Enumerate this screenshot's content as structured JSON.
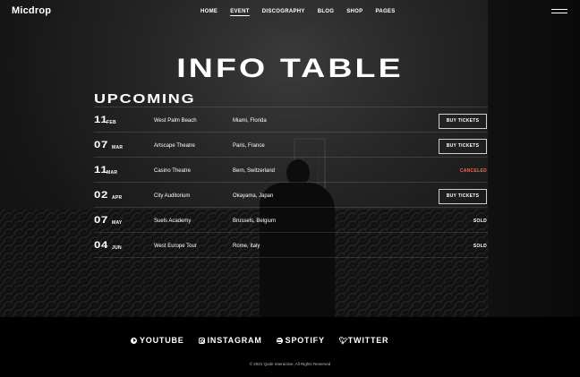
{
  "header": {
    "logo": "Micdrop",
    "nav": [
      "HOME",
      "EVENT",
      "DISCOGRAPHY",
      "BLOG",
      "SHOP",
      "PAGES"
    ],
    "active_nav": "EVENT"
  },
  "page_title": "INFO TABLE",
  "section_title": "UPCOMING",
  "events": [
    {
      "day": "11",
      "month": "FEB",
      "venue": "West Palm Beach",
      "location": "Miami, Florida",
      "action": "BUY TICKETS"
    },
    {
      "day": "07",
      "month": "MAR",
      "venue": "Artscape Theatre",
      "location": "Paris, France",
      "action": "BUY TICKETS"
    },
    {
      "day": "11",
      "month": "MAR",
      "venue": "Casino Theatre",
      "location": "Bern, Switzerland",
      "status": "CANCELED"
    },
    {
      "day": "02",
      "month": "APR",
      "venue": "City Auditorium",
      "location": "Okayama, Japan",
      "action": "BUY TICKETS"
    },
    {
      "day": "07",
      "month": "MAY",
      "venue": "Suels Academy",
      "location": "Brussels, Belgium",
      "status": "SOLD"
    },
    {
      "day": "04",
      "month": "JUN",
      "venue": "West Europe Tour",
      "location": "Rome, Italy",
      "status": "SOLD"
    }
  ],
  "footer": {
    "socials": [
      {
        "label": "YOUTUBE",
        "icon": "youtube-icon"
      },
      {
        "label": "INSTAGRAM",
        "icon": "instagram-icon"
      },
      {
        "label": "SPOTIFY",
        "icon": "spotify-icon"
      },
      {
        "label": "TWITTER",
        "icon": "twitter-icon"
      }
    ],
    "copyright": "© 2021 Qode Interactive, All Rights Reserved"
  },
  "colors": {
    "canceled": "#e06f5e",
    "background": "#000000"
  }
}
